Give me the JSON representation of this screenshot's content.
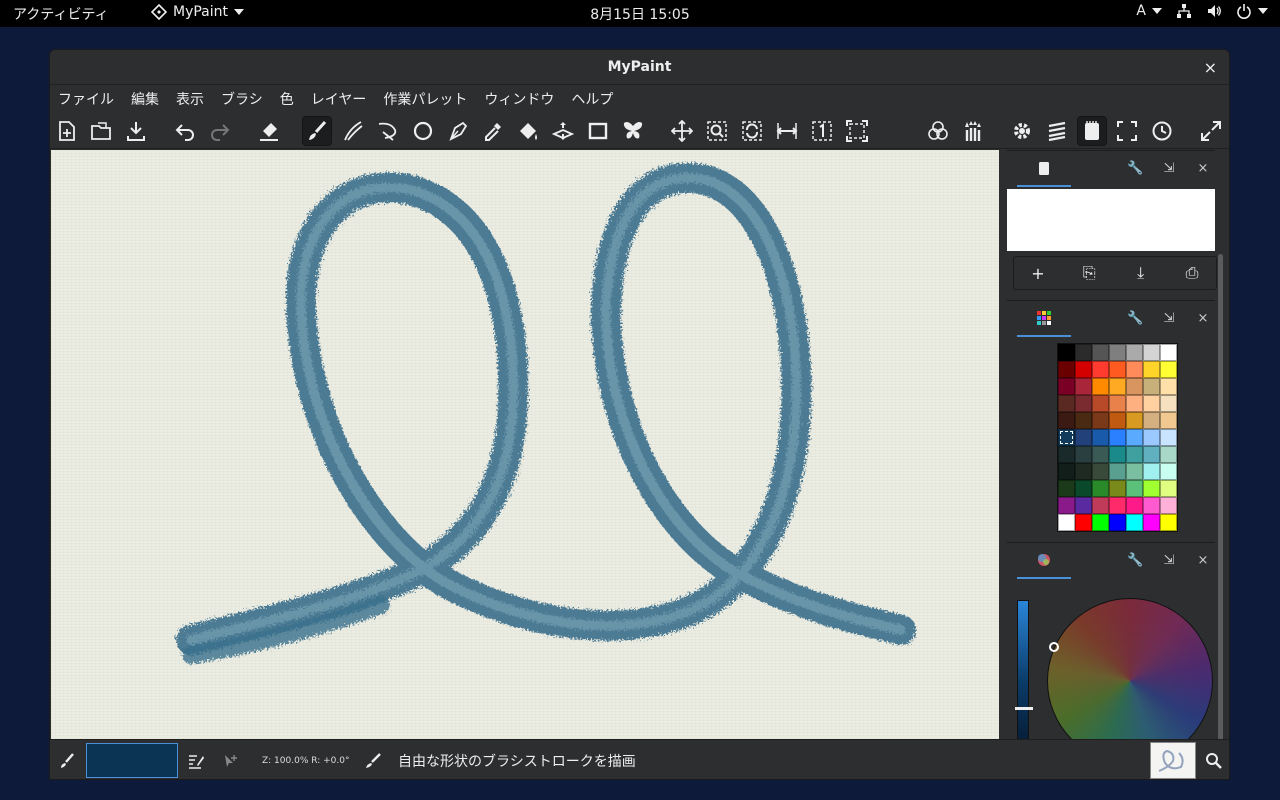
{
  "topbar": {
    "activities": "アクティビティ",
    "app_name": "MyPaint",
    "clock": "8月15日  15:05",
    "input_method": "A"
  },
  "window": {
    "title": "MyPaint",
    "close_glyph": "×"
  },
  "menu": {
    "file": "ファイル",
    "edit": "編集",
    "view": "表示",
    "brush": "ブラシ",
    "color": "色",
    "layer": "レイヤー",
    "scratchpad": "作業パレット",
    "window": "ウィンドウ",
    "help": "ヘルプ"
  },
  "colors": {
    "accent": "#4a90d9",
    "stroke": "#3a6f8c",
    "current_color": "#0b3354",
    "canvas": "#ecede2"
  },
  "panels": {
    "close_glyph": "×",
    "layer_buttons": [
      "+",
      "⎘",
      "⤓",
      "⎙"
    ]
  },
  "palette": [
    "#000000",
    "#2b2b2b",
    "#555555",
    "#7f7f7f",
    "#aaaaaa",
    "#d4d4d4",
    "#ffffff",
    "#6b0000",
    "#d40000",
    "#ff3b2f",
    "#ff5a1f",
    "#ff8a5a",
    "#ffd42a",
    "#ffff33",
    "#7a0026",
    "#a8253a",
    "#ff8a00",
    "#ffaa22",
    "#d99560",
    "#c8b07a",
    "#ffe0a8",
    "#5a2a22",
    "#7a2b30",
    "#b84a2a",
    "#e8824a",
    "#ffb080",
    "#ffd0a0",
    "#f5e0c0",
    "#3a1a12",
    "#4a2a12",
    "#7a3a1a",
    "#c05a10",
    "#d89a20",
    "#d4b080",
    "#f0c890",
    "#123a5a",
    "#22407a",
    "#1a5aaa",
    "#2a80ff",
    "#5aaaff",
    "#9ac8ff",
    "#c8e4ff",
    "#1a2a2a",
    "#2a4040",
    "#3a5a55",
    "#1a8a8a",
    "#40a0a0",
    "#60b0c0",
    "#a8d8c8",
    "#121e1a",
    "#1e2a22",
    "#3a4a3a",
    "#5aa090",
    "#7ac0a0",
    "#a0f0f0",
    "#c8fff0",
    "#1a3a1a",
    "#0a4a2a",
    "#2a8a2a",
    "#7a8a1a",
    "#5ac07a",
    "#a0ff30",
    "#e0ff80",
    "#8a1a8a",
    "#5a2aa0",
    "#c03a5a",
    "#ff2a6a",
    "#ff1a8a",
    "#ff5ad0",
    "#ffb0d8",
    "#ffffff",
    "#ff0000",
    "#00ff00",
    "#0000ff",
    "#00ffff",
    "#ff00ff",
    "#ffff00"
  ],
  "status": {
    "zoom_rotation": "Z: 100.0% R: +0.0°",
    "message": "自由な形状のブラシストロークを描画"
  }
}
